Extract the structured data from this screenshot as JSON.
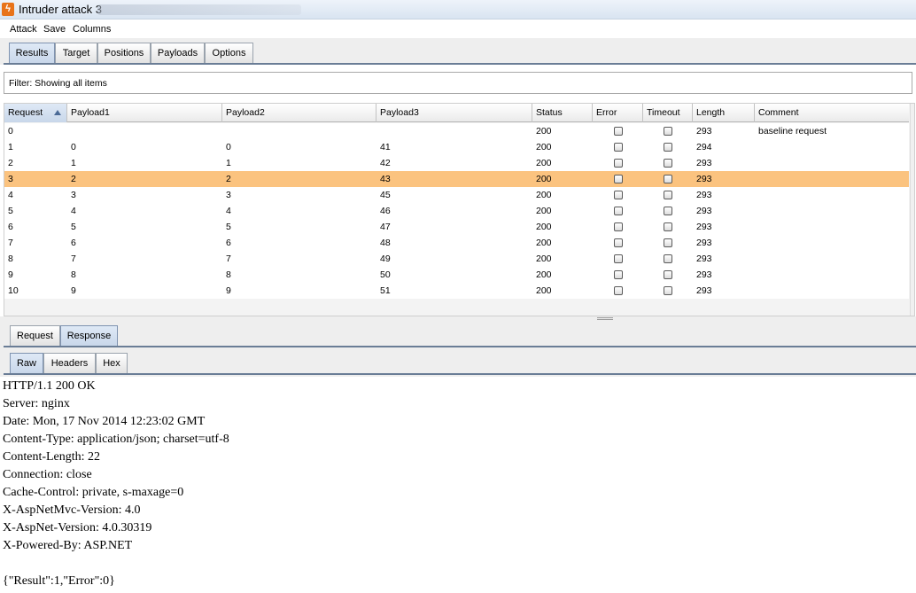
{
  "window": {
    "title": "Intruder attack 3"
  },
  "menu": [
    "Attack",
    "Save",
    "Columns"
  ],
  "tabs": [
    {
      "label": "Results",
      "active": true
    },
    {
      "label": "Target",
      "active": false
    },
    {
      "label": "Positions",
      "active": false
    },
    {
      "label": "Payloads",
      "active": false
    },
    {
      "label": "Options",
      "active": false
    }
  ],
  "filter": {
    "text": "Filter:  Showing all items"
  },
  "table": {
    "sort_column": "Request",
    "sort_direction": "ascending",
    "columns": [
      "Request",
      "Payload1",
      "Payload2",
      "Payload3",
      "Status",
      "Error",
      "Timeout",
      "Length",
      "Comment"
    ],
    "rows": [
      {
        "request": "0",
        "payload1": "",
        "payload2": "",
        "payload3": "",
        "status": "200",
        "error": false,
        "timeout": false,
        "length": "293",
        "comment": "baseline request",
        "selected": false
      },
      {
        "request": "1",
        "payload1": "0",
        "payload2": "0",
        "payload3": "41",
        "status": "200",
        "error": false,
        "timeout": false,
        "length": "294",
        "comment": "",
        "selected": false
      },
      {
        "request": "2",
        "payload1": "1",
        "payload2": "1",
        "payload3": "42",
        "status": "200",
        "error": false,
        "timeout": false,
        "length": "293",
        "comment": "",
        "selected": false
      },
      {
        "request": "3",
        "payload1": "2",
        "payload2": "2",
        "payload3": "43",
        "status": "200",
        "error": false,
        "timeout": false,
        "length": "293",
        "comment": "",
        "selected": true
      },
      {
        "request": "4",
        "payload1": "3",
        "payload2": "3",
        "payload3": "45",
        "status": "200",
        "error": false,
        "timeout": false,
        "length": "293",
        "comment": "",
        "selected": false
      },
      {
        "request": "5",
        "payload1": "4",
        "payload2": "4",
        "payload3": "46",
        "status": "200",
        "error": false,
        "timeout": false,
        "length": "293",
        "comment": "",
        "selected": false
      },
      {
        "request": "6",
        "payload1": "5",
        "payload2": "5",
        "payload3": "47",
        "status": "200",
        "error": false,
        "timeout": false,
        "length": "293",
        "comment": "",
        "selected": false
      },
      {
        "request": "7",
        "payload1": "6",
        "payload2": "6",
        "payload3": "48",
        "status": "200",
        "error": false,
        "timeout": false,
        "length": "293",
        "comment": "",
        "selected": false
      },
      {
        "request": "8",
        "payload1": "7",
        "payload2": "7",
        "payload3": "49",
        "status": "200",
        "error": false,
        "timeout": false,
        "length": "293",
        "comment": "",
        "selected": false
      },
      {
        "request": "9",
        "payload1": "8",
        "payload2": "8",
        "payload3": "50",
        "status": "200",
        "error": false,
        "timeout": false,
        "length": "293",
        "comment": "",
        "selected": false
      },
      {
        "request": "10",
        "payload1": "9",
        "payload2": "9",
        "payload3": "51",
        "status": "200",
        "error": false,
        "timeout": false,
        "length": "293",
        "comment": "",
        "selected": false
      }
    ]
  },
  "message_tabs": [
    {
      "label": "Request",
      "active": false
    },
    {
      "label": "Response",
      "active": true
    }
  ],
  "view_tabs": [
    {
      "label": "Raw",
      "active": true
    },
    {
      "label": "Headers",
      "active": false
    },
    {
      "label": "Hex",
      "active": false
    }
  ],
  "response": {
    "lines": [
      "HTTP/1.1 200 OK",
      "Server: nginx",
      "Date: Mon, 17 Nov 2014 12:23:02 GMT",
      "Content-Type: application/json; charset=utf-8",
      "Content-Length: 22",
      "Connection: close",
      "Cache-Control: private, s-maxage=0",
      "X-AspNetMvc-Version: 4.0",
      "X-AspNet-Version: 4.0.30319",
      "X-Powered-By: ASP.NET",
      "",
      "{\"Result\":1,\"Error\":0}"
    ]
  },
  "colors": {
    "selected_row": "#fbc37f",
    "active_tab": "#c9d7ea",
    "tab_underline": "#6a7d96"
  }
}
